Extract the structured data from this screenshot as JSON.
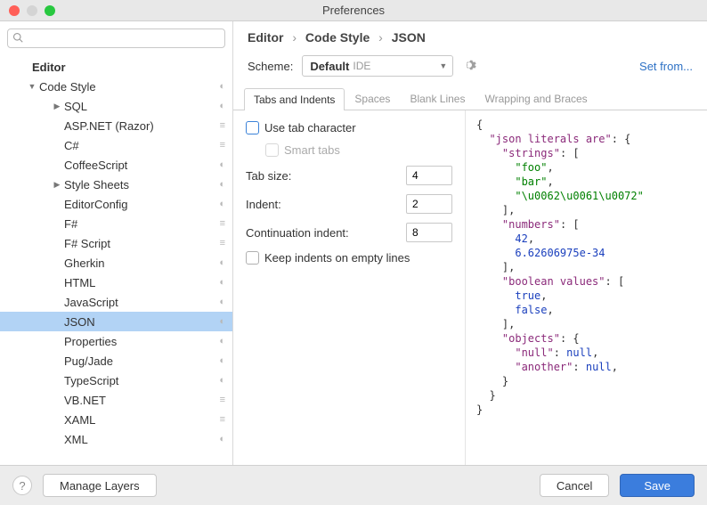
{
  "window": {
    "title": "Preferences"
  },
  "search": {
    "placeholder": ""
  },
  "tree": [
    {
      "label": "Editor",
      "depth": 0,
      "twisty": "none",
      "marker": ""
    },
    {
      "label": "Code Style",
      "depth": 1,
      "twisty": "down",
      "marker": "◐"
    },
    {
      "label": "SQL",
      "depth": 2,
      "twisty": "right",
      "marker": "◐"
    },
    {
      "label": "ASP.NET (Razor)",
      "depth": 2,
      "twisty": "none",
      "marker": "≡"
    },
    {
      "label": "C#",
      "depth": 2,
      "twisty": "none",
      "marker": "≡"
    },
    {
      "label": "CoffeeScript",
      "depth": 2,
      "twisty": "none",
      "marker": "◐"
    },
    {
      "label": "Style Sheets",
      "depth": 2,
      "twisty": "right",
      "marker": "◐"
    },
    {
      "label": "EditorConfig",
      "depth": 2,
      "twisty": "none",
      "marker": "◐"
    },
    {
      "label": "F#",
      "depth": 2,
      "twisty": "none",
      "marker": "≡"
    },
    {
      "label": "F# Script",
      "depth": 2,
      "twisty": "none",
      "marker": "≡"
    },
    {
      "label": "Gherkin",
      "depth": 2,
      "twisty": "none",
      "marker": "◐"
    },
    {
      "label": "HTML",
      "depth": 2,
      "twisty": "none",
      "marker": "◐"
    },
    {
      "label": "JavaScript",
      "depth": 2,
      "twisty": "none",
      "marker": "◐"
    },
    {
      "label": "JSON",
      "depth": 2,
      "twisty": "none",
      "marker": "◐",
      "selected": true
    },
    {
      "label": "Properties",
      "depth": 2,
      "twisty": "none",
      "marker": "◐"
    },
    {
      "label": "Pug/Jade",
      "depth": 2,
      "twisty": "none",
      "marker": "◐"
    },
    {
      "label": "TypeScript",
      "depth": 2,
      "twisty": "none",
      "marker": "◐"
    },
    {
      "label": "VB.NET",
      "depth": 2,
      "twisty": "none",
      "marker": "≡"
    },
    {
      "label": "XAML",
      "depth": 2,
      "twisty": "none",
      "marker": "≡"
    },
    {
      "label": "XML",
      "depth": 2,
      "twisty": "none",
      "marker": "◐"
    }
  ],
  "breadcrumb": {
    "a": "Editor",
    "b": "Code Style",
    "c": "JSON"
  },
  "scheme": {
    "label": "Scheme:",
    "value": "Default",
    "suffix": "IDE",
    "setfrom": "Set from..."
  },
  "tabs": [
    "Tabs and Indents",
    "Spaces",
    "Blank Lines",
    "Wrapping and Braces"
  ],
  "form": {
    "use_tab": "Use tab character",
    "smart_tabs": "Smart tabs",
    "tab_size_label": "Tab size:",
    "tab_size": "4",
    "indent_label": "Indent:",
    "indent": "2",
    "cont_label": "Continuation indent:",
    "cont": "8",
    "keep_indents": "Keep indents on empty lines"
  },
  "preview": {
    "l01": "{",
    "l02a": "  ",
    "l02k": "\"json literals are\"",
    "l02b": ": {",
    "l03a": "    ",
    "l03k": "\"strings\"",
    "l03b": ": [",
    "l04a": "      ",
    "l04s": "\"foo\"",
    "l04b": ",",
    "l05a": "      ",
    "l05s": "\"bar\"",
    "l05b": ",",
    "l06a": "      ",
    "l06s": "\"\\u0062\\u0061\\u0072\"",
    "l07": "    ],",
    "l08a": "    ",
    "l08k": "\"numbers\"",
    "l08b": ": [",
    "l09a": "      ",
    "l09n": "42",
    "l09b": ",",
    "l10a": "      ",
    "l10n": "6.62606975e-34",
    "l11": "    ],",
    "l12a": "    ",
    "l12k": "\"boolean values\"",
    "l12b": ": [",
    "l13a": "      ",
    "l13n": "true",
    "l13b": ",",
    "l14a": "      ",
    "l14n": "false",
    "l14b": ",",
    "l15": "    ],",
    "l16a": "    ",
    "l16k": "\"objects\"",
    "l16b": ": {",
    "l17a": "      ",
    "l17k": "\"null\"",
    "l17b": ": ",
    "l17n": "null",
    "l17c": ",",
    "l18a": "      ",
    "l18k": "\"another\"",
    "l18b": ": ",
    "l18n": "null",
    "l18c": ",",
    "l19": "    }",
    "l20": "  }",
    "l21": "}"
  },
  "footer": {
    "manage": "Manage Layers",
    "cancel": "Cancel",
    "save": "Save"
  }
}
